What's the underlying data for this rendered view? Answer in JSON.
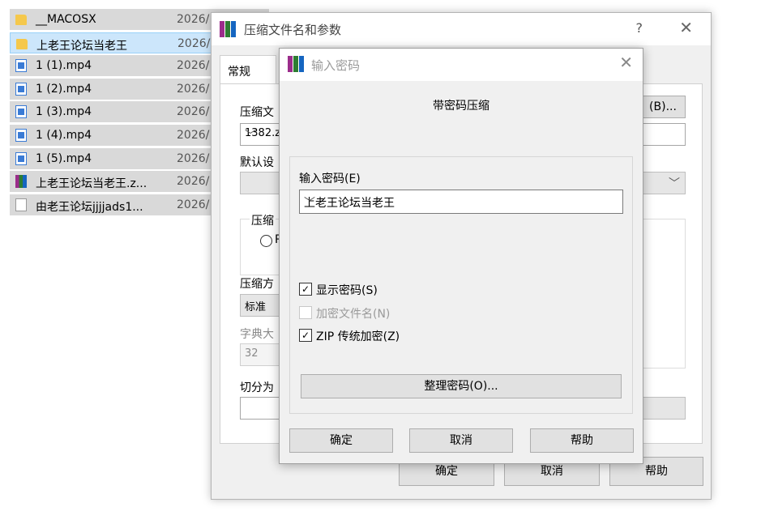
{
  "file_list": [
    {
      "name": "__MACOSX",
      "date": "2026/",
      "icon": "folder-icon",
      "selected": false
    },
    {
      "name": "上老王论坛当老王",
      "date": "2026/",
      "icon": "folder-icon",
      "selected": true
    },
    {
      "name": "1 (1).mp4",
      "date": "2026/",
      "icon": "video-file-icon",
      "selected": false
    },
    {
      "name": "1 (2).mp4",
      "date": "2026/",
      "icon": "video-file-icon",
      "selected": false
    },
    {
      "name": "1 (3).mp4",
      "date": "2026/",
      "icon": "video-file-icon",
      "selected": false
    },
    {
      "name": "1 (4).mp4",
      "date": "2026/",
      "icon": "video-file-icon",
      "selected": false
    },
    {
      "name": "1 (5).mp4",
      "date": "2026/",
      "icon": "video-file-icon",
      "selected": false
    },
    {
      "name": "上老王论坛当老王.z...",
      "date": "2026/",
      "icon": "rar-archive-icon",
      "selected": false
    },
    {
      "name": "由老王论坛jjjjads1...",
      "date": "2026/",
      "icon": "text-file-icon",
      "selected": false
    }
  ],
  "main_dialog": {
    "title": "压缩文件名和参数",
    "help_symbol": "?",
    "close_symbol": "✕",
    "tab_general": "常规",
    "archive_name_label": "压缩文",
    "archive_name_value": "1382.z",
    "browse_button": "(B)...",
    "default_profile_label": "默认设",
    "archive_format_label": "压缩",
    "archive_format_option": "R",
    "method_label": "压缩方",
    "method_value": "标准",
    "dict_label": "字典大",
    "dict_value": "32",
    "split_label": "切分为",
    "ok_button": "确定",
    "cancel_button": "取消",
    "help_button": "帮助"
  },
  "password_dialog": {
    "title": "输入密码",
    "close_symbol": "✕",
    "heading": "带密码压缩",
    "password_label": "输入密码(E)",
    "password_value": "上老王论坛当老王",
    "show_password_label": "显示密码(S)",
    "show_password_checked": true,
    "encrypt_names_label": "加密文件名(N)",
    "encrypt_names_checked": false,
    "zip_legacy_label": "ZIP 传统加密(Z)",
    "zip_legacy_checked": true,
    "organize_button": "整理密码(O)...",
    "ok_button": "确定",
    "cancel_button": "取消",
    "help_button": "帮助"
  },
  "colors": {
    "winrar_icon_purple": "#9b2d8b",
    "winrar_icon_green": "#2e7d32",
    "winrar_icon_blue": "#1565c0",
    "selection_bg": "#cce6fb",
    "folder": "#f5c84c"
  }
}
